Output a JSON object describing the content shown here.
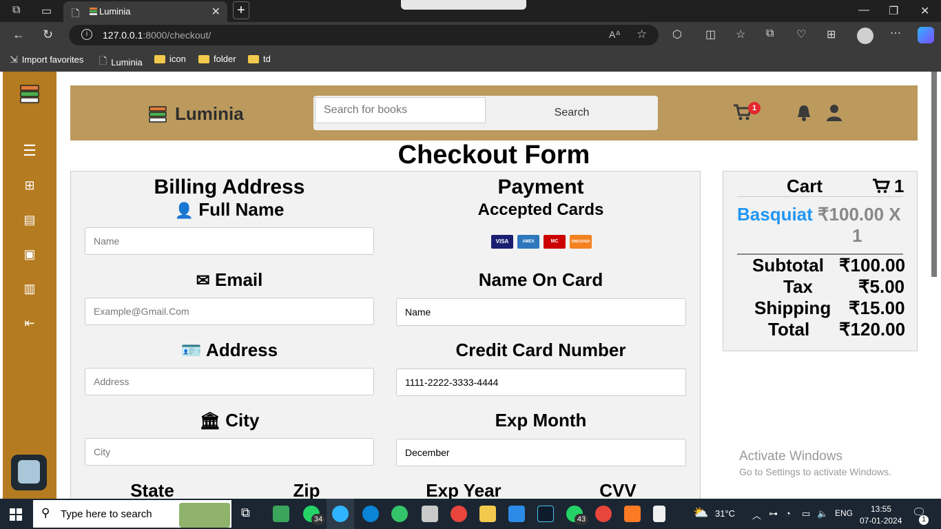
{
  "browser": {
    "tab_title": "Luminia",
    "url_host": "127.0.0.1",
    "url_path": ":8000/checkout/",
    "bookmarks": [
      "Import favorites",
      "Luminia",
      "icon",
      "folder",
      "td"
    ]
  },
  "header": {
    "logo": "Luminia",
    "search_placeholder": "Search for books",
    "search_button": "Search",
    "cart_count": "1"
  },
  "form": {
    "title": "Checkout Form",
    "billing": {
      "heading": "Billing Address",
      "full_name_label": "Full Name",
      "full_name_placeholder": "Name",
      "email_label": "Email",
      "email_placeholder": "Example@Gmail.Com",
      "address_label": "Address",
      "address_placeholder": "Address",
      "city_label": "City",
      "city_placeholder": "City",
      "state_label": "State",
      "zip_label": "Zip"
    },
    "payment": {
      "heading": "Payment",
      "accepted_label": "Accepted Cards",
      "cards": [
        "VISA",
        "AMEX",
        "MC",
        "DISCOVER"
      ],
      "name_on_card_label": "Name On Card",
      "name_on_card_value": "Name",
      "cc_label": "Credit Card Number",
      "cc_value": "1111-2222-3333-4444",
      "exp_month_label": "Exp Month",
      "exp_month_value": "December",
      "exp_year_label": "Exp Year",
      "cvv_label": "CVV"
    }
  },
  "cart": {
    "title": "Cart",
    "count": "1",
    "item_name": "Basquiat",
    "item_price": "₹100.00 X",
    "item_qty": "1",
    "subtotal_label": "Subtotal",
    "subtotal": "₹100.00",
    "tax_label": "Tax",
    "tax": "₹5.00",
    "shipping_label": "Shipping",
    "shipping": "₹15.00",
    "total_label": "Total",
    "total": "₹120.00"
  },
  "watermark": {
    "line1": "Activate Windows",
    "line2": "Go to Settings to activate Windows."
  },
  "taskbar": {
    "search_text": "Type here to search",
    "badge_whatsapp1": "34",
    "badge_whatsapp2": "43",
    "weather": "31°C",
    "lang": "ENG",
    "time": "13:55",
    "date": "07-01-2024",
    "notif_count": "1"
  }
}
